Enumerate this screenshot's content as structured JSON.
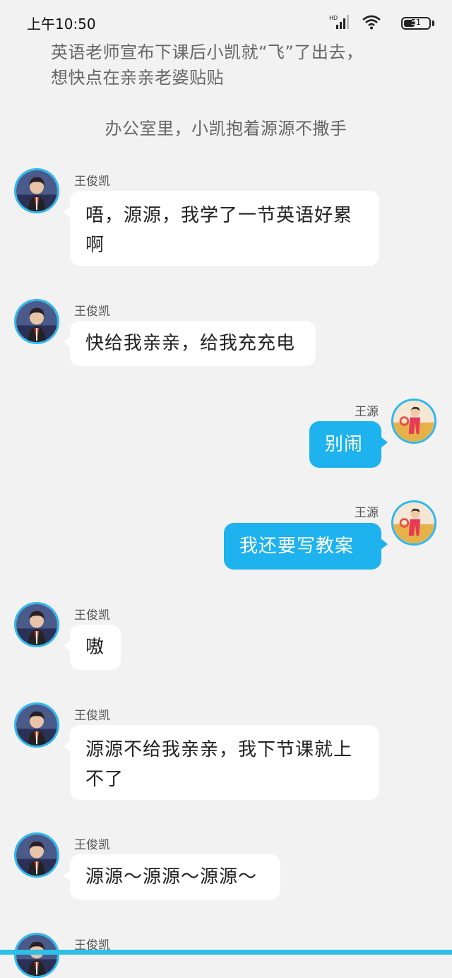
{
  "status": {
    "time": "上午10:50",
    "battery": "51",
    "battery_level": 0.51
  },
  "narration": {
    "line1": "英语老师宣布下课后小凯就“飞”了出去，",
    "line2": "想快点在亲亲老婆贴贴",
    "center": "办公室里，小凯抱着源源不撒手"
  },
  "messages": [
    {
      "side": "left",
      "name": "王俊凯",
      "lines": [
        "唔，源源，我学了一节英语好累",
        "啊"
      ]
    },
    {
      "side": "left",
      "name": "王俊凯",
      "lines": [
        "快给我亲亲，给我充充电"
      ]
    },
    {
      "side": "right",
      "name": "王源",
      "lines": [
        "别闹"
      ]
    },
    {
      "side": "right",
      "name": "王源",
      "lines": [
        "我还要写教案"
      ]
    },
    {
      "side": "left",
      "name": "王俊凯",
      "lines": [
        "嗷"
      ]
    },
    {
      "side": "left",
      "name": "王俊凯",
      "lines": [
        "源源不给我亲亲，我下节课就上",
        "不了"
      ]
    },
    {
      "side": "left",
      "name": "王俊凯",
      "lines": [
        "源源～源源～源源～"
      ]
    },
    {
      "side": "left",
      "name": "王俊凯",
      "lines": []
    }
  ],
  "colors": {
    "bubble_right": "#1eb2ee",
    "avatar_ring": "#2fb7f0",
    "background": "#f2f2f2"
  }
}
